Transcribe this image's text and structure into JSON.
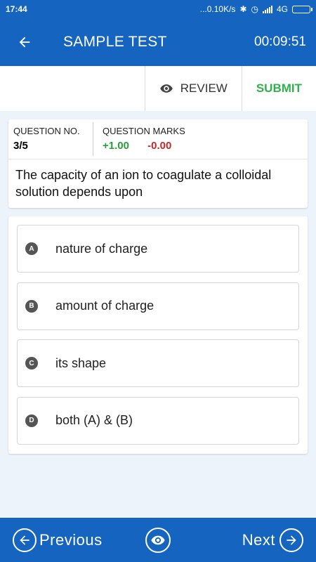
{
  "status_bar": {
    "time": "17:44",
    "net_speed": "...0.10K/s",
    "network": "4G"
  },
  "app_bar": {
    "title": "SAMPLE TEST",
    "timer": "00:09:51",
    "back_icon": "arrow-left-icon"
  },
  "actions": {
    "review_label": "REVIEW",
    "review_icon": "eye-icon",
    "submit_label": "SUBMIT",
    "submit_color": "#2fb24b"
  },
  "question": {
    "number_label": "QUESTION NO.",
    "number_value": "3/5",
    "marks_label": "QUESTION MARKS",
    "marks_plus": "+1.00",
    "marks_minus": "-0.00",
    "text": "The capacity of an ion to coagulate a colloidal solution depends upon"
  },
  "options": [
    {
      "letter": "A",
      "text": "nature of charge"
    },
    {
      "letter": "B",
      "text": "amount of charge"
    },
    {
      "letter": "C",
      "text": "its shape"
    },
    {
      "letter": "D",
      "text": "both (A) & (B)"
    }
  ],
  "bottom_bar": {
    "previous_label": "Previous",
    "next_label": "Next",
    "review_icon": "eye-icon"
  },
  "colors": {
    "primary": "#1565c0",
    "background": "#edf3fb",
    "plus": "#2a9d3a",
    "minus": "#c62828"
  }
}
